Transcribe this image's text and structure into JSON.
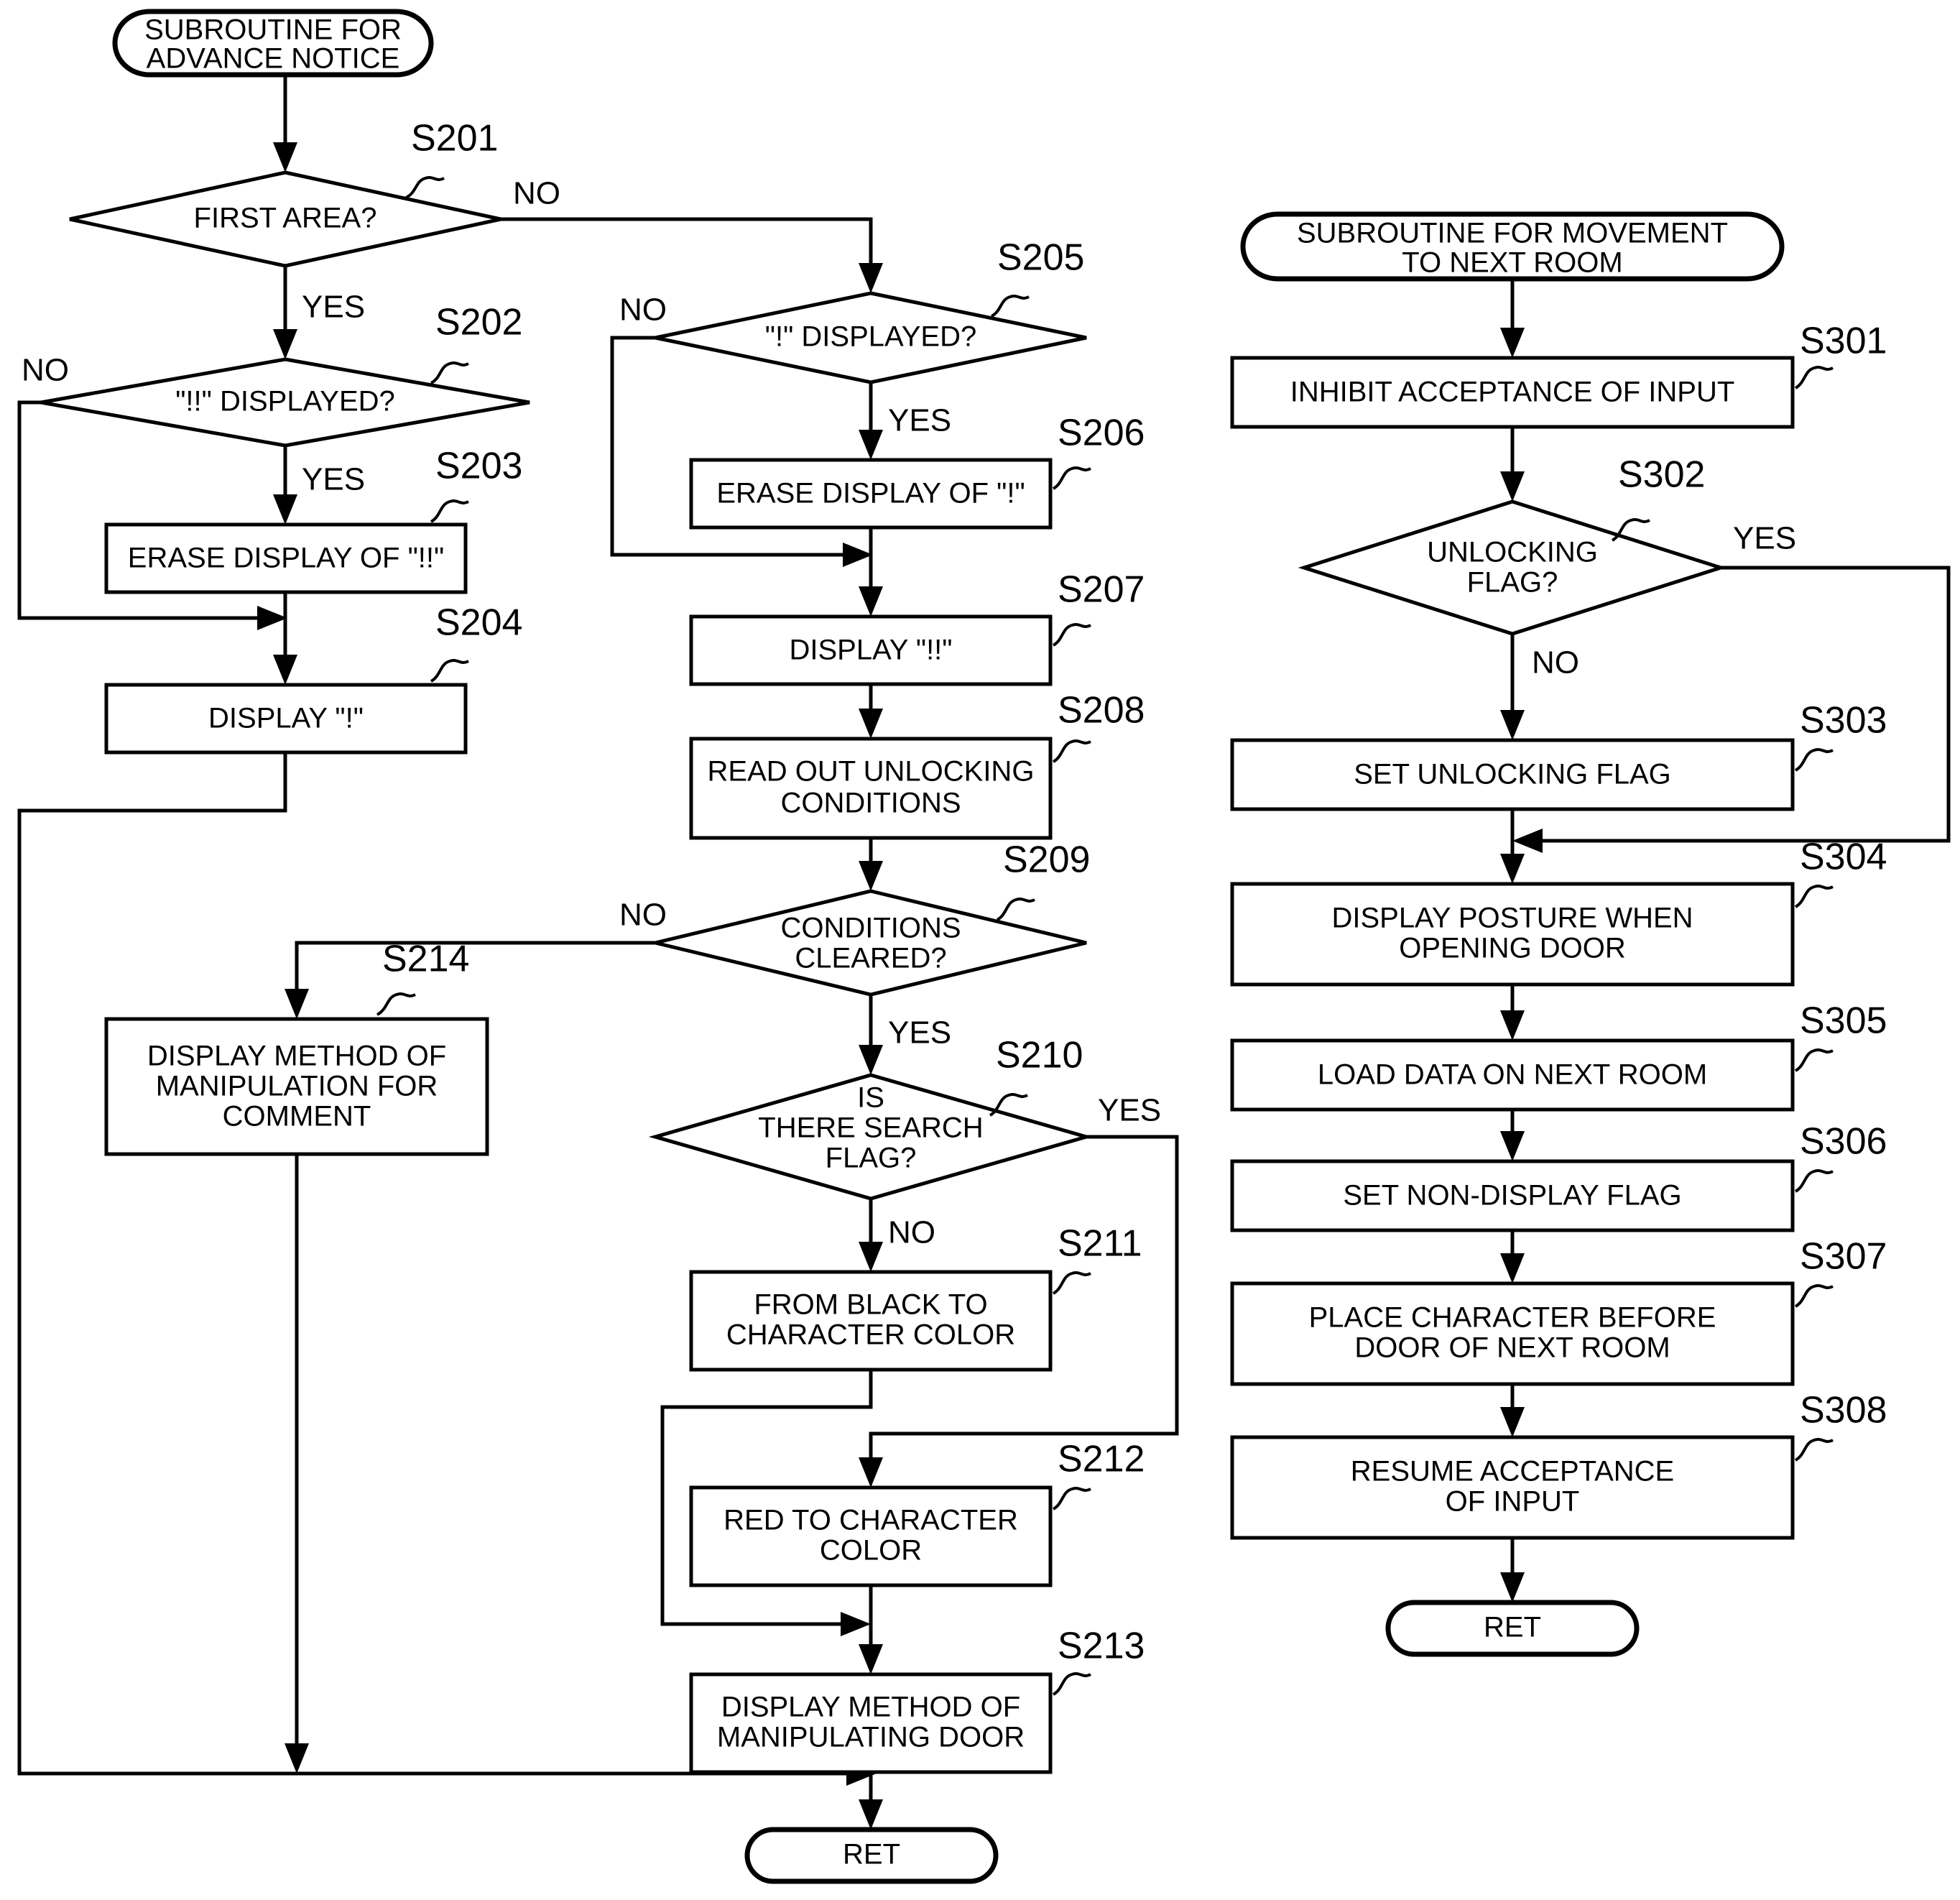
{
  "diagram": {
    "title": "Flowchart: Subroutine for advance notice and subroutine for movement to next room",
    "line_color": "#000000",
    "fill_color": "#ffffff"
  },
  "left_flow": {
    "start_terminal": "SUBROUTINE FOR\nADVANCE NOTICE",
    "s201": {
      "id": "S201",
      "text": "FIRST AREA?",
      "yes": "YES",
      "no": "NO"
    },
    "s202": {
      "id": "S202",
      "text": "\"!!\" DISPLAYED?",
      "yes": "YES",
      "no": "NO"
    },
    "s203": {
      "id": "S203",
      "text": "ERASE DISPLAY OF \"!!\""
    },
    "s204": {
      "id": "S204",
      "text": "DISPLAY \"!\""
    },
    "s214": {
      "id": "S214",
      "text": "DISPLAY METHOD OF\nMANIPULATION FOR\nCOMMENT"
    }
  },
  "middle_flow": {
    "s205": {
      "id": "S205",
      "text": "\"!\" DISPLAYED?",
      "yes": "YES",
      "no": "NO"
    },
    "s206": {
      "id": "S206",
      "text": "ERASE DISPLAY OF \"!\""
    },
    "s207": {
      "id": "S207",
      "text": "DISPLAY \"!!\""
    },
    "s208": {
      "id": "S208",
      "text": "READ OUT UNLOCKING\nCONDITIONS"
    },
    "s209": {
      "id": "S209",
      "text": "CONDITIONS\nCLEARED?",
      "yes": "YES",
      "no": "NO"
    },
    "s210": {
      "id": "S210",
      "text": "IS\nTHERE SEARCH\nFLAG?",
      "yes": "YES",
      "no": "NO"
    },
    "s211": {
      "id": "S211",
      "text": "FROM BLACK TO\nCHARACTER COLOR"
    },
    "s212": {
      "id": "S212",
      "text": "RED TO CHARACTER\nCOLOR"
    },
    "s213": {
      "id": "S213",
      "text": "DISPLAY METHOD OF\nMANIPULATING DOOR"
    },
    "end_terminal": "RET"
  },
  "right_flow": {
    "start_terminal": "SUBROUTINE FOR MOVEMENT\nTO NEXT ROOM",
    "s301": {
      "id": "S301",
      "text": "INHIBIT ACCEPTANCE OF INPUT"
    },
    "s302": {
      "id": "S302",
      "text": "UNLOCKING\nFLAG?",
      "yes": "YES",
      "no": "NO"
    },
    "s303": {
      "id": "S303",
      "text": "SET UNLOCKING FLAG"
    },
    "s304": {
      "id": "S304",
      "text": "DISPLAY POSTURE WHEN\nOPENING DOOR"
    },
    "s305": {
      "id": "S305",
      "text": "LOAD DATA ON NEXT ROOM"
    },
    "s306": {
      "id": "S306",
      "text": "SET NON-DISPLAY FLAG"
    },
    "s307": {
      "id": "S307",
      "text": "PLACE CHARACTER BEFORE\nDOOR OF NEXT ROOM"
    },
    "s308": {
      "id": "S308",
      "text": "RESUME ACCEPTANCE\nOF INPUT"
    },
    "end_terminal": "RET"
  }
}
